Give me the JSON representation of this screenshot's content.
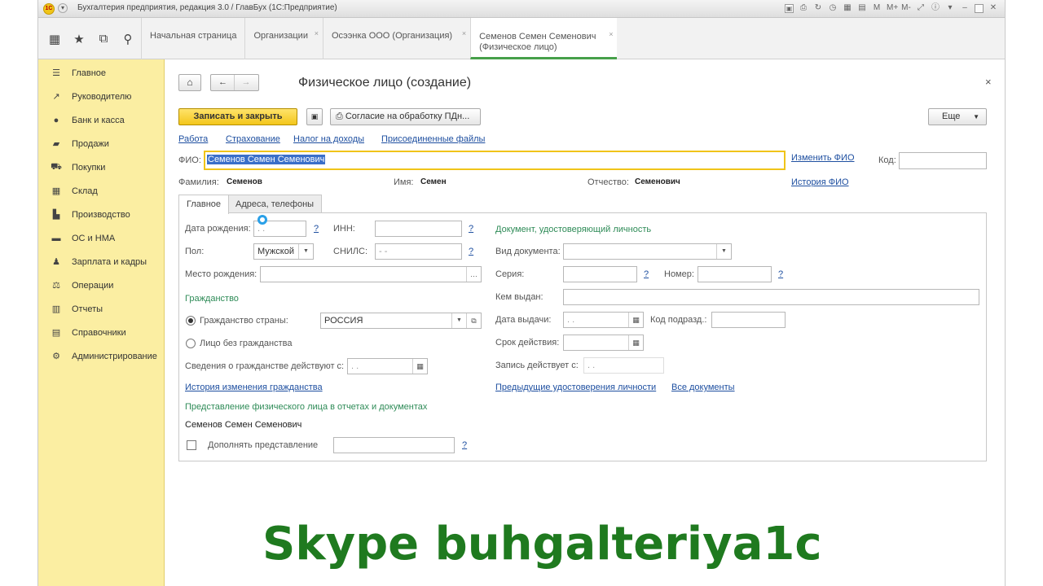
{
  "window": {
    "title": "Бухгалтерия предприятия, редакция 3.0 / ГлавБух  (1С:Предприятие)",
    "tools_right": [
      "M",
      "M+",
      "M-"
    ]
  },
  "tabs": [
    {
      "label": "Начальная страница"
    },
    {
      "label": "Организации"
    },
    {
      "label": "Осээнка ООО (Организация)"
    },
    {
      "label_line1": "Семенов Семен Семенович",
      "label_line2": "(Физическое лицо)"
    }
  ],
  "sidebar": {
    "items": [
      {
        "label": "Главное"
      },
      {
        "label": "Руководителю"
      },
      {
        "label": "Банк и касса"
      },
      {
        "label": "Продажи"
      },
      {
        "label": "Покупки"
      },
      {
        "label": "Склад"
      },
      {
        "label": "Производство"
      },
      {
        "label": "ОС и НМА"
      },
      {
        "label": "Зарплата и кадры"
      },
      {
        "label": "Операции"
      },
      {
        "label": "Отчеты"
      },
      {
        "label": "Справочники"
      },
      {
        "label": "Администрирование"
      }
    ]
  },
  "form": {
    "title": "Физическое лицо (создание)",
    "save_close": "Записать и закрыть",
    "consent": "Согласие на обработку ПДн...",
    "more": "Еще",
    "links": [
      "Работа",
      "Страхование",
      "Налог на доходы",
      "Присоединенные файлы"
    ],
    "fio_label": "ФИО:",
    "fio_value": "Семенов Семен Семенович",
    "change_fio": "Изменить ФИО",
    "history_fio": "История ФИО",
    "code_label": "Код:",
    "surname_label": "Фамилия:",
    "surname": "Семенов",
    "name_label": "Имя:",
    "name": "Семен",
    "patronymic_label": "Отчество:",
    "patronymic": "Семенович",
    "tab_main": "Главное",
    "tab_address": "Адреса, телефоны",
    "birth_date_label": "Дата рождения:",
    "date_placeholder": " .  .",
    "inn_label": "ИНН:",
    "gender_label": "Пол:",
    "gender": "Мужской",
    "snils_label": "СНИЛС:",
    "snils_placeholder": " -   -",
    "birthplace_label": "Место рождения:",
    "citizenship_header": "Гражданство",
    "citizenship_country_label": "Гражданство страны:",
    "country": "РОССИЯ",
    "stateless_label": "Лицо без гражданства",
    "citizenship_valid_label": "Сведения о гражданстве действуют с:",
    "citizenship_history": "История изменения гражданства",
    "representation_header": "Представление физического лица в отчетах и документах",
    "representation_value": "Семенов Семен Семенович",
    "supplement_label": "Дополнять представление",
    "doc_header": "Документ, удостоверяющий личность",
    "doc_type_label": "Вид документа:",
    "series_label": "Серия:",
    "number_label": "Номер:",
    "issued_by_label": "Кем выдан:",
    "issue_date_label": "Дата выдачи:",
    "division_code_label": "Код подразд.:",
    "valid_until_label": "Срок действия:",
    "record_valid_label": "Запись действует с:",
    "prev_docs": "Предыдущие удостоверения личности",
    "all_docs": "Все документы",
    "help": "?"
  },
  "watermark": "Skype buhgalteriya1c"
}
